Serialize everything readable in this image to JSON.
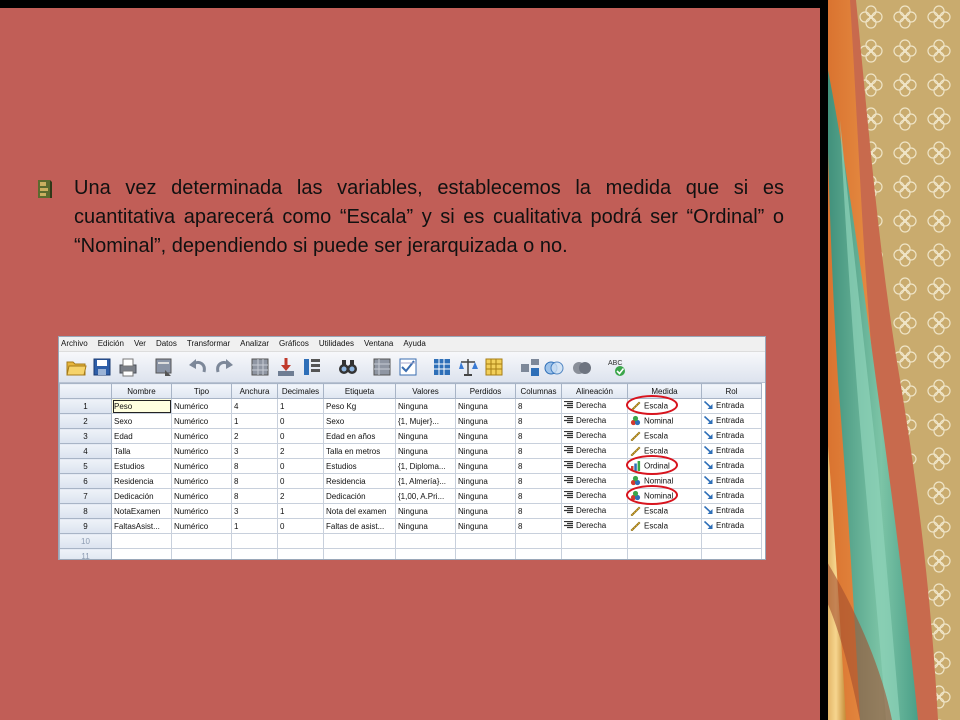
{
  "slide": {
    "paragraph": "Una vez determinada las variables, establecemos la medida que si es cuantitativa aparecerá  como “Escala” y si es cualitativa podrá ser “Ordinal” o “Nominal”, dependiendo  si puede ser jerarquizada o no."
  },
  "colors": {
    "background": "#c15e57",
    "circle": "#d8141e"
  },
  "spss": {
    "menu": [
      "Archivo",
      "Edición",
      "Ver",
      "Datos",
      "Transformar",
      "Analizar",
      "Gráficos",
      "Utilidades",
      "Ventana",
      "Ayuda"
    ],
    "toolbar_icons": [
      "open-folder-icon",
      "save-icon",
      "print-icon",
      "dialog-recall-icon",
      "undo-icon",
      "redo-icon",
      "goto-case-icon",
      "goto-variable-icon",
      "variables-icon",
      "find-icon",
      "insert-cases-icon",
      "insert-variable-icon",
      "split-file-icon",
      "weight-cases-icon",
      "select-cases-icon",
      "value-labels-icon",
      "use-sets-icon",
      "show-all-icon",
      "spell-check-icon"
    ],
    "columns": [
      "Nombre",
      "Tipo",
      "Anchura",
      "Decimales",
      "Etiqueta",
      "Valores",
      "Perdidos",
      "Columnas",
      "Alineación",
      "Medida",
      "Rol"
    ],
    "rows": [
      {
        "n": "1",
        "nombre": "Peso",
        "tipo": "Numérico",
        "anchura": "4",
        "decimales": "1",
        "etiqueta": "Peso Kg",
        "valores": "Ninguna",
        "perdidos": "Ninguna",
        "columnas": "8",
        "alineacion": "Derecha",
        "medida": "Escala",
        "medida_icon": "scale-ruler-icon",
        "rol": "Entrada",
        "circled": true
      },
      {
        "n": "2",
        "nombre": "Sexo",
        "tipo": "Numérico",
        "anchura": "1",
        "decimales": "0",
        "etiqueta": "Sexo",
        "valores": "{1, Mujer}...",
        "perdidos": "Ninguna",
        "columnas": "8",
        "alineacion": "Derecha",
        "medida": "Nominal",
        "medida_icon": "nominal-circles-icon",
        "rol": "Entrada",
        "circled": false
      },
      {
        "n": "3",
        "nombre": "Edad",
        "tipo": "Numérico",
        "anchura": "2",
        "decimales": "0",
        "etiqueta": "Edad en años",
        "valores": "Ninguna",
        "perdidos": "Ninguna",
        "columnas": "8",
        "alineacion": "Derecha",
        "medida": "Escala",
        "medida_icon": "scale-ruler-icon",
        "rol": "Entrada",
        "circled": false
      },
      {
        "n": "4",
        "nombre": "Talla",
        "tipo": "Numérico",
        "anchura": "3",
        "decimales": "2",
        "etiqueta": "Talla en metros",
        "valores": "Ninguna",
        "perdidos": "Ninguna",
        "columnas": "8",
        "alineacion": "Derecha",
        "medida": "Escala",
        "medida_icon": "scale-ruler-icon",
        "rol": "Entrada",
        "circled": false
      },
      {
        "n": "5",
        "nombre": "Estudios",
        "tipo": "Numérico",
        "anchura": "8",
        "decimales": "0",
        "etiqueta": "Estudios",
        "valores": "{1, Diploma...",
        "perdidos": "Ninguna",
        "columnas": "8",
        "alineacion": "Derecha",
        "medida": "Ordinal",
        "medida_icon": "ordinal-bars-icon",
        "rol": "Entrada",
        "circled": true
      },
      {
        "n": "6",
        "nombre": "Residencia",
        "tipo": "Numérico",
        "anchura": "8",
        "decimales": "0",
        "etiqueta": "Residencia",
        "valores": "{1, Almería}...",
        "perdidos": "Ninguna",
        "columnas": "8",
        "alineacion": "Derecha",
        "medida": "Nominal",
        "medida_icon": "nominal-circles-icon",
        "rol": "Entrada",
        "circled": false
      },
      {
        "n": "7",
        "nombre": "Dedicación",
        "tipo": "Numérico",
        "anchura": "8",
        "decimales": "2",
        "etiqueta": "Dedicación",
        "valores": "{1,00, A.Pri...",
        "perdidos": "Ninguna",
        "columnas": "8",
        "alineacion": "Derecha",
        "medida": "Nominal",
        "medida_icon": "nominal-circles-icon",
        "rol": "Entrada",
        "circled": true
      },
      {
        "n": "8",
        "nombre": "NotaExamen",
        "tipo": "Numérico",
        "anchura": "3",
        "decimales": "1",
        "etiqueta": "Nota del examen",
        "valores": "Ninguna",
        "perdidos": "Ninguna",
        "columnas": "8",
        "alineacion": "Derecha",
        "medida": "Escala",
        "medida_icon": "scale-ruler-icon",
        "rol": "Entrada",
        "circled": false
      },
      {
        "n": "9",
        "nombre": "FaltasAsist...",
        "tipo": "Numérico",
        "anchura": "1",
        "decimales": "0",
        "etiqueta": "Faltas de asist...",
        "valores": "Ninguna",
        "perdidos": "Ninguna",
        "columnas": "8",
        "alineacion": "Derecha",
        "medida": "Escala",
        "medida_icon": "scale-ruler-icon",
        "rol": "Entrada",
        "circled": false
      },
      {
        "n": "10",
        "empty": true
      },
      {
        "n": "11",
        "empty": true
      }
    ]
  }
}
